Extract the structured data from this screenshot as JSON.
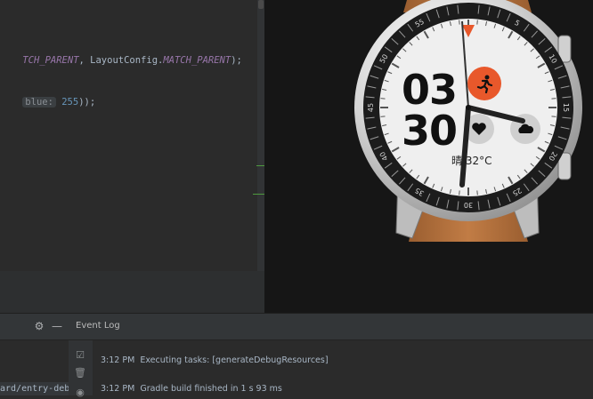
{
  "editor": {
    "line1": {
      "const1": "TCH_PARENT",
      "sep": ", LayoutConfig.",
      "const2": "MATCH_PARENT",
      "tail": ");"
    },
    "line2": {
      "hint": "blue:",
      "num": "255",
      "tail": "));"
    }
  },
  "watch": {
    "hours": "03",
    "minutes": "30",
    "weather": "晴 32°C",
    "bezel_numbers": [
      "5",
      "10",
      "15",
      "20",
      "25",
      "30",
      "35",
      "40",
      "45",
      "50",
      "55"
    ],
    "icons": [
      "running-icon",
      "heart-icon",
      "cloud-icon"
    ]
  },
  "bottom_panel": {
    "path": "ard/entry-debug",
    "event_log_title": "Event Log",
    "log_entries": [
      {
        "time": "3:12 PM",
        "message": "Executing tasks: [generateDebugResources]"
      },
      {
        "time": "3:12 PM",
        "message": "Gradle build finished in 1 s 93 ms"
      }
    ]
  },
  "colors": {
    "accent_orange": "#e8582b",
    "editor_bg": "#2b2b2b",
    "preview_bg": "#161616",
    "strap_brown": "#b8753f"
  }
}
